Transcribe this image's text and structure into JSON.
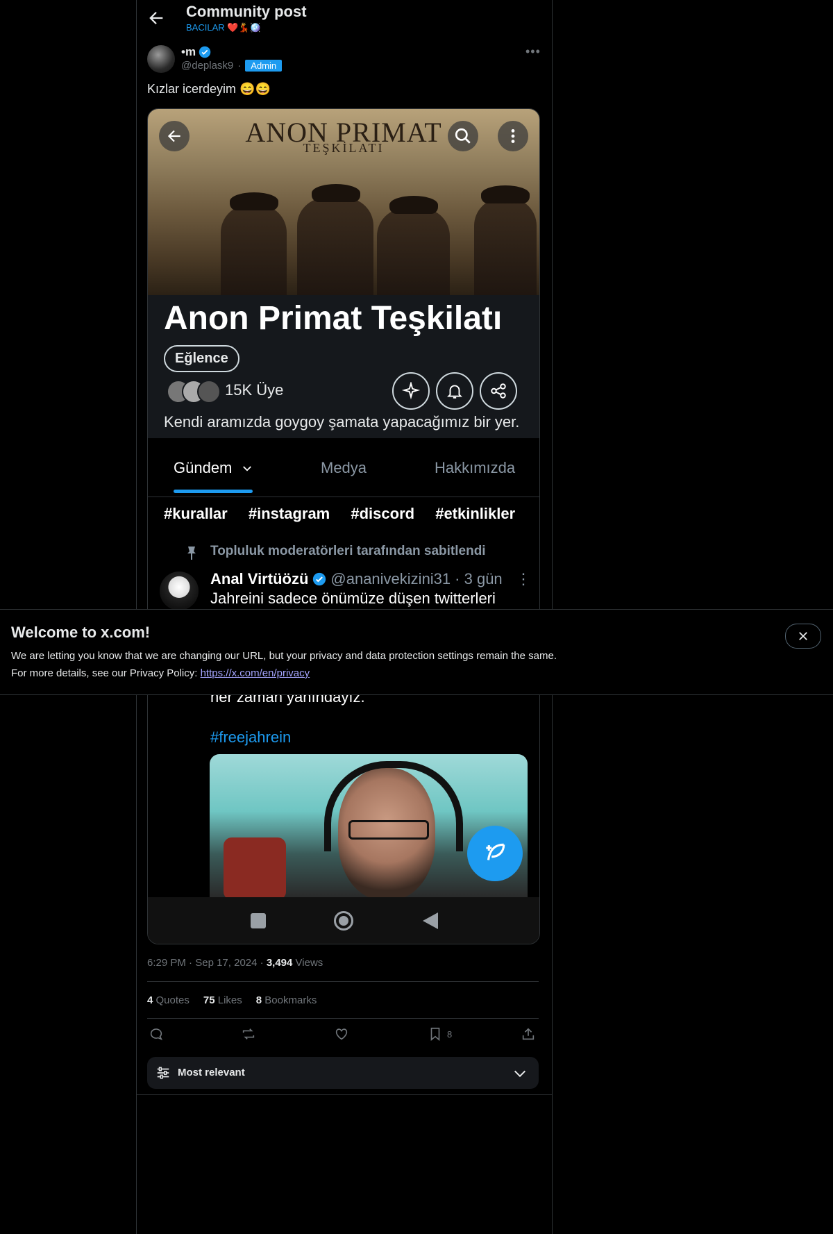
{
  "header": {
    "title": "Community post",
    "subtitle": "BACILAR ❤️💃🪩"
  },
  "post": {
    "author_name": "•m",
    "handle": "@deplask9",
    "role_badge": "Admin",
    "text": "Kızlar icerdeyim 😄😄",
    "timestamp": "6:29 PM",
    "date": "Sep 17, 2024",
    "views_count": "3,494",
    "views_label": "Views",
    "stats": {
      "quotes_count": "4",
      "quotes_label": "Quotes",
      "likes_count": "75",
      "likes_label": "Likes",
      "bookmarks_count": "8",
      "bookmarks_label": "Bookmarks"
    },
    "bookmark_action_count": "8"
  },
  "screenshot": {
    "banner_title": "ANON PRIMAT",
    "banner_subtitle": "TEŞKİLATI",
    "community_name": "Anon Primat Teşkilatı",
    "category": "Eğlence",
    "members": "15K Üye",
    "description": "Kendi aramızda goygoy şamata yapacağımız bir yer.",
    "tabs": [
      {
        "label": "Gündem"
      },
      {
        "label": "Medya"
      },
      {
        "label": "Hakkımızda"
      }
    ],
    "tags": [
      "#kurallar",
      "#instagram",
      "#discord",
      "#etkinlikler"
    ],
    "pinned_label": "Topluluk moderatörleri tarafından sabitlendi",
    "inner_post": {
      "author": "Anal Virtüözü",
      "handle": "@ananivekizini31",
      "age": "· 3 gün",
      "text_line1": "Jahreini sadece önümüze düşen twitterleri",
      "text_line2": "her zaman yanındayız.",
      "hashtag": "#freejahrein"
    }
  },
  "sort": {
    "label": "Most relevant"
  },
  "notice": {
    "title": "Welcome to x.com!",
    "line1": "We are letting you know that we are changing our URL, but your privacy and data protection settings remain the same.",
    "line2_prefix": "For more details, see our Privacy Policy: ",
    "link": "https://x.com/en/privacy"
  },
  "colors": {
    "accent": "#1d9bf0",
    "background": "#000000",
    "muted": "#71767b"
  }
}
